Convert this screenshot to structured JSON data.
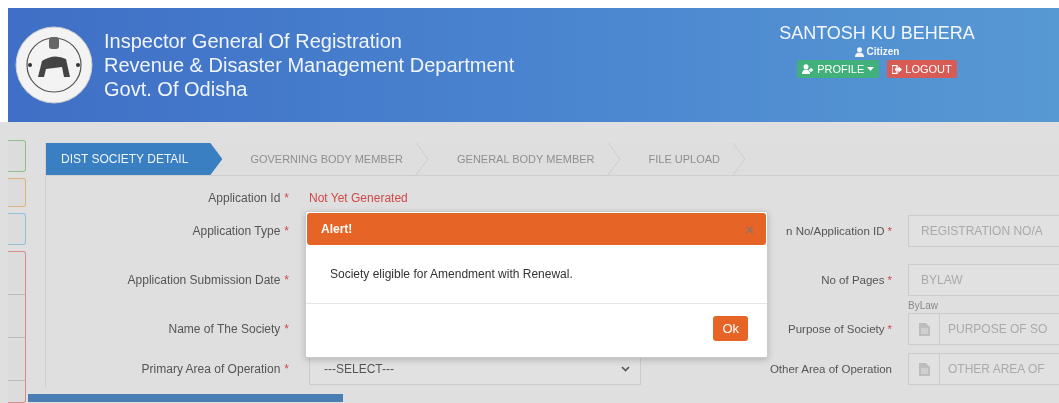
{
  "header": {
    "title_lines": [
      "Inspector General Of Registration",
      "Revenue & Disaster Management Department",
      "Govt. Of Odisha"
    ],
    "user_name": "SANTOSH KU BEHERA",
    "role": "Citizen",
    "profile_button": "PROFILE",
    "logout_button": "LOGOUT"
  },
  "tabs": [
    {
      "label": "DIST SOCIETY DETAIL",
      "selected": true
    },
    {
      "label": "GOVERNING BODY MEMBER",
      "selected": false
    },
    {
      "label": "GENERAL BODY MEMBER",
      "selected": false
    },
    {
      "label": "FILE UPLOAD",
      "selected": false
    }
  ],
  "required_mark": "*",
  "form_rows": [
    {
      "left": {
        "label": "Application Id",
        "required": true,
        "kind": "value",
        "value": "Not Yet Generated"
      }
    },
    {
      "left": {
        "label": "Application Type",
        "required": true,
        "kind": "label"
      },
      "right": {
        "label": "n No/Application ID",
        "required": true,
        "kind": "input",
        "placeholder": "REGISTRATION NO/A"
      }
    },
    {
      "left": {
        "label": "Application Submission Date",
        "required": true,
        "kind": "label"
      },
      "right": {
        "label": "No of Pages",
        "required": true,
        "kind": "input",
        "placeholder": "BYLAW",
        "help": "ByLaw"
      }
    },
    {
      "left": {
        "label": "Name of The Society",
        "required": true,
        "kind": "label"
      },
      "right": {
        "label": "Purpose of Society",
        "required": true,
        "kind": "icon-input",
        "placeholder": "PURPOSE OF SO"
      }
    },
    {
      "left": {
        "label": "Primary Area of Operation",
        "required": true,
        "kind": "select",
        "value": "---SELECT---"
      },
      "right": {
        "label": "Other Area of Operation",
        "required": false,
        "kind": "icon-input",
        "placeholder": "OTHER AREA OF"
      }
    }
  ],
  "alert": {
    "title": "Alert!",
    "close": "×",
    "message": "Society eligible for Amendment with Renewal.",
    "ok_button": "Ok"
  }
}
